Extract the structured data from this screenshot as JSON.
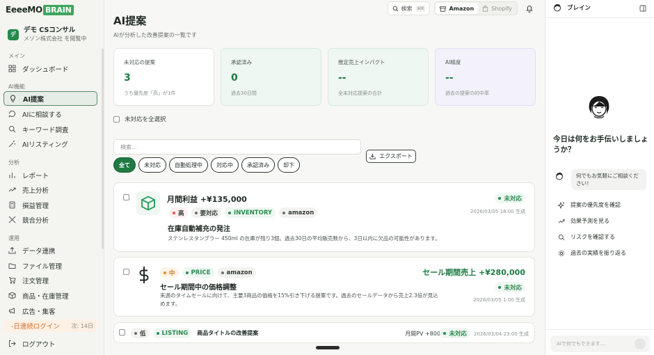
{
  "brand": {
    "logo_left": "EeeeMO",
    "logo_right": "BRAIN"
  },
  "workspace": {
    "avatar": "デ",
    "name": "デモ CSコンサル",
    "sub": "メゾン株式会社 を閲覧中"
  },
  "sidebar": {
    "sections": {
      "menu": "メイン",
      "ai": "AI機能",
      "analysis": "分析",
      "ops": "運用"
    },
    "items": {
      "dashboard": "ダッシュボード",
      "ai_proposals": "AI提案",
      "ai_consult": "AIに相談する",
      "keyword": "キーワード調査",
      "ai_listing": "AIリスティング",
      "report": "レポート",
      "sales": "売上分析",
      "pnl": "損益管理",
      "competitor": "競合分析",
      "data_link": "データ連携",
      "files": "ファイル管理",
      "orders": "注文管理",
      "products": "商品・在庫管理",
      "ads": "広告・集客",
      "streak": "-日連続ログイン",
      "streak_days": "次: 14日",
      "logout": "ログアウト"
    }
  },
  "topbar": {
    "search": "検索",
    "search_kbd": "⌘K",
    "amazon": "Amazon",
    "shopify": "Shopify"
  },
  "page": {
    "title": "AI提案",
    "subtitle": "AIが分析した改善提案の一覧です"
  },
  "stats": [
    {
      "label": "未対応の提案",
      "value": "3",
      "note": "うち優先度「高」が1件"
    },
    {
      "label": "承認済み",
      "value": "0",
      "note": "過去30日間"
    },
    {
      "label": "推定売上インパクト",
      "value": "--",
      "note": "全未対応提案の合計"
    },
    {
      "label": "AI精度",
      "value": "--",
      "note": "過去の提案の的中率"
    }
  ],
  "select_all": "未対応を全選択",
  "filter": {
    "placeholder": "検索...",
    "export": "エクスポート"
  },
  "chips": [
    "全て",
    "未対応",
    "自動処理中",
    "対応中",
    "承認済み",
    "却下"
  ],
  "cards": [
    {
      "headline": "月間利益 +¥135,000",
      "tags": [
        "高",
        "要対応",
        "INVENTORY",
        "amazon"
      ],
      "status": "未対応",
      "date": "2026/03/05 18:00 生成",
      "title": "在庫自動補充の発注",
      "desc": "ステンレスタンブラー 450ml の在庫が残り3個。過去30日の平均販売数から、3日以内に欠品の可能性があります。"
    },
    {
      "tags": [
        "中",
        "PRICE",
        "amazon"
      ],
      "impact": "セール期間売上 +¥280,000",
      "status": "未対応",
      "date": "2026/03/05 1:00 生成",
      "title": "セール期間中の価格調整",
      "desc": "来週のタイムセールに向けて、主要3商品の価格を15%引き下げる提案です。過去のセールデータから売上2.3倍が見込めます。"
    },
    {
      "tags": [
        "低",
        "LISTING"
      ],
      "title": "商品タイトルの改善提案",
      "impact": "月間PV +800",
      "status": "未対応",
      "date": "2026/03/04 23:00 生成"
    }
  ],
  "panel": {
    "title": "ブレイン",
    "greeting": "今日は何をお手伝いしましょうか？",
    "bubble": "何でもお気軽にご相談ください！",
    "actions": [
      "提案の優先度を確認",
      "効果予測を見る",
      "リスクを確認する",
      "過去の実績を振り返る"
    ],
    "input_placeholder": "AIで何でもできます..."
  },
  "colors": {
    "brand_green": "#3ea55d",
    "accent_green": "#1f7a44",
    "streak_orange": "#d0722f"
  }
}
